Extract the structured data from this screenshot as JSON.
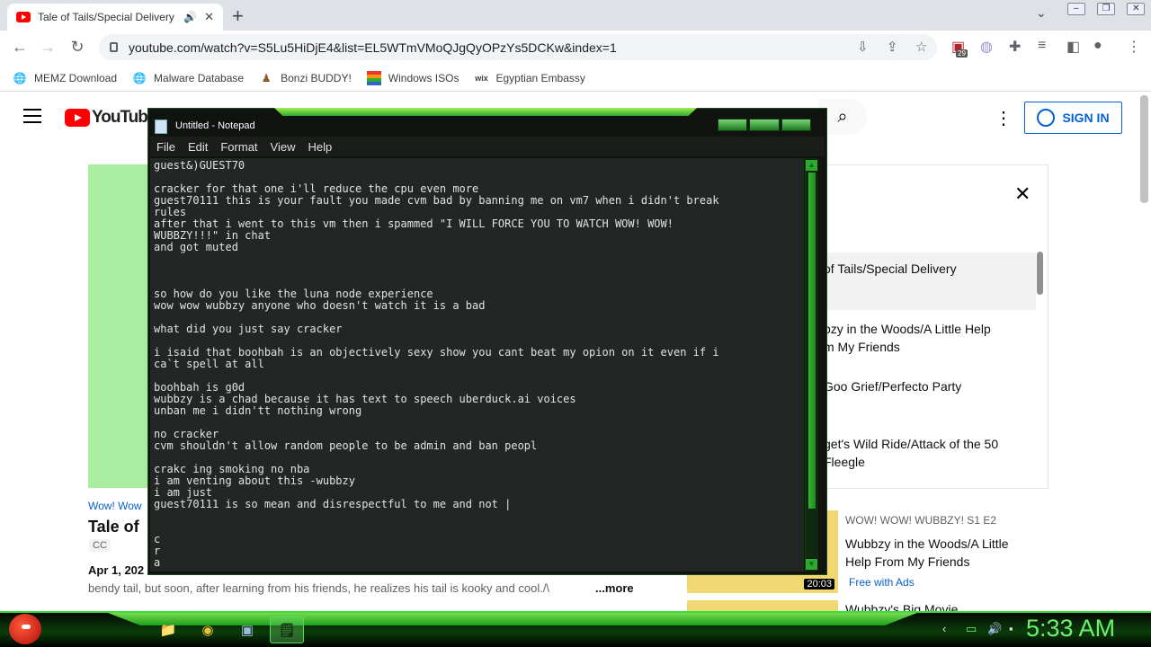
{
  "browser": {
    "tab_title": "Tale of Tails/Special Delivery",
    "tab_close": "✕",
    "new_tab": "+",
    "url": "youtube.com/watch?v=S5Lu5HiDjE4&list=EL5WTmVMoQJgQyOPzYs5DCKw&index=1",
    "extension_badge": "29",
    "bookmarks": [
      {
        "label": "MEMZ Download",
        "icon": "globe-icon"
      },
      {
        "label": "Malware Database",
        "icon": "globe-icon"
      },
      {
        "label": "Bonzi BUDDY!",
        "icon": "bonzi-icon"
      },
      {
        "label": "Windows ISOs",
        "icon": "windows-flag-icon"
      },
      {
        "label": "Egyptian Embassy",
        "icon": "wix-icon"
      }
    ]
  },
  "youtube": {
    "logo": "YouTube",
    "sign_in": "SIGN IN",
    "video": {
      "channel": "Wow! Wow",
      "title": "Tale of",
      "cc": "CC",
      "date": "Apr 1, 202",
      "description": "bendy tail, but soon, after learning from his friends, he realizes his tail is kooky and cool./\\",
      "more": "...more"
    },
    "playlist": [
      {
        "title": "of Tails/Special Delivery"
      },
      {
        "title": "bzy in the Woods/A Little Help\nm My Friends"
      },
      {
        "title": "Goo Grief/Perfecto Party"
      },
      {
        "title": "get's Wild Ride/Attack of the 50\nFleegle"
      }
    ],
    "recommendations": [
      {
        "tag": "WOW! WOW! WUBBZY!  S1 E2",
        "title": "Wubbzy in the Woods/A Little Help From My Friends",
        "badge": "Free with Ads",
        "duration": "20:03"
      },
      {
        "tag": "",
        "title": "Wubbzy's Big Movie",
        "badge": "",
        "duration": ""
      }
    ]
  },
  "notepad": {
    "title": "Untitled - Notepad",
    "menu": [
      "File",
      "Edit",
      "Format",
      "View",
      "Help"
    ],
    "text": "guest&)GUEST70\n\ncracker for that one i'll reduce the cpu even more\nguest70111 this is your fault you made cvm bad by banning me on vm7 when i didn't break\nrules\nafter that i went to this vm then i spammed \"I WILL FORCE YOU TO WATCH WOW! WOW!\nWUBBZY!!!\" in chat\nand got muted\n\n\n\nso how do you like the luna node experience\nwow wow wubbzy anyone who doesn't watch it is a bad\n\nwhat did you just say cracker\n\ni isaid that boohbah is an objectively sexy show you cant beat my opion on it even if i\nca`t spell at all\n\nboohbah is g0d\nwubbzy is a chad because it has text to speech uberduck.ai voices\nunban me i didn'tt nothing wrong\n\nno cracker\ncvm shouldn't allow random people to be admin and ban peopl\n\ncrakc ing smoking no nba\ni am venting about this -wubbzy\ni am just\nguest70111 is so mean and disrespectful to me and not |\n\n\nc\nr\na"
  },
  "taskbar": {
    "clock": "5:33 AM",
    "apps": [
      {
        "name": "file-explorer",
        "icon": "📁"
      },
      {
        "name": "chrome",
        "icon": "◉"
      },
      {
        "name": "remote-desktop",
        "icon": "▣"
      },
      {
        "name": "notepad",
        "icon": "🗒"
      }
    ]
  }
}
